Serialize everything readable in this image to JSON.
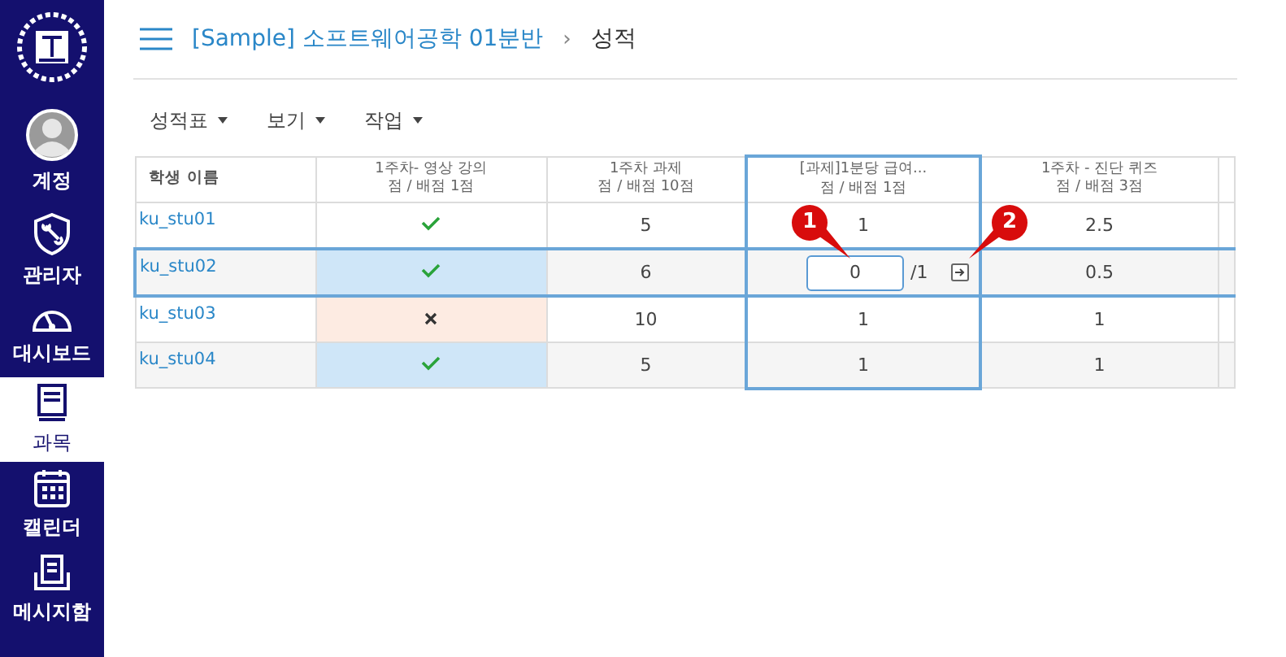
{
  "sidebar": {
    "items": [
      {
        "label": "계정",
        "kind": "avatar",
        "selected": false
      },
      {
        "label": "관리자",
        "kind": "shield",
        "selected": false
      },
      {
        "label": "대시보드",
        "kind": "gauge",
        "selected": false
      },
      {
        "label": "과목",
        "kind": "book",
        "selected": true
      },
      {
        "label": "캘린더",
        "kind": "calendar",
        "selected": false
      },
      {
        "label": "메시지함",
        "kind": "inbox",
        "selected": false
      }
    ]
  },
  "breadcrumb": {
    "course": "[Sample] 소프트웨어공학 01분반",
    "separator": "›",
    "page": "성적"
  },
  "toolbar": [
    {
      "label": "성적표"
    },
    {
      "label": "보기"
    },
    {
      "label": "작업"
    }
  ],
  "table": {
    "columns": [
      {
        "title": "학생 이름",
        "selected": false
      },
      {
        "title": "1주차- 영상 강의",
        "subtitle": "점 / 배점 1점",
        "selected": false
      },
      {
        "title": "1주차 과제",
        "subtitle": "점 / 배점 10점",
        "selected": false
      },
      {
        "title": "[과제]1분당 급여...",
        "subtitle": "점 / 배점 1점",
        "selected": true
      },
      {
        "title": "1주차 - 진단 퀴즈",
        "subtitle": "점 / 배점 3점",
        "selected": false
      }
    ],
    "rows": [
      {
        "selected": false,
        "cells": [
          {
            "kind": "student",
            "value": "ku_stu01"
          },
          {
            "kind": "check"
          },
          {
            "kind": "text",
            "value": "5"
          },
          {
            "kind": "text",
            "value": "1"
          },
          {
            "kind": "text",
            "value": "2.5"
          }
        ]
      },
      {
        "selected": true,
        "cells": [
          {
            "kind": "student",
            "value": "ku_stu02"
          },
          {
            "kind": "check",
            "color": "#cfe6f8"
          },
          {
            "kind": "text",
            "value": "6"
          },
          {
            "kind": "edit",
            "value": "0",
            "total": "/1"
          },
          {
            "kind": "text",
            "value": "0.5"
          }
        ]
      },
      {
        "selected": false,
        "cells": [
          {
            "kind": "student",
            "value": "ku_stu03"
          },
          {
            "kind": "cross",
            "color": "#fdebe2"
          },
          {
            "kind": "text",
            "value": "10"
          },
          {
            "kind": "text",
            "value": "1"
          },
          {
            "kind": "text",
            "value": "1"
          }
        ]
      },
      {
        "selected": false,
        "cells": [
          {
            "kind": "student",
            "value": "ku_stu04"
          },
          {
            "kind": "check",
            "color": "#cfe6f8"
          },
          {
            "kind": "text",
            "value": "5"
          },
          {
            "kind": "text",
            "value": "1"
          },
          {
            "kind": "text",
            "value": "1"
          }
        ]
      }
    ]
  },
  "callouts": [
    {
      "number": "1"
    },
    {
      "number": "2"
    }
  ]
}
